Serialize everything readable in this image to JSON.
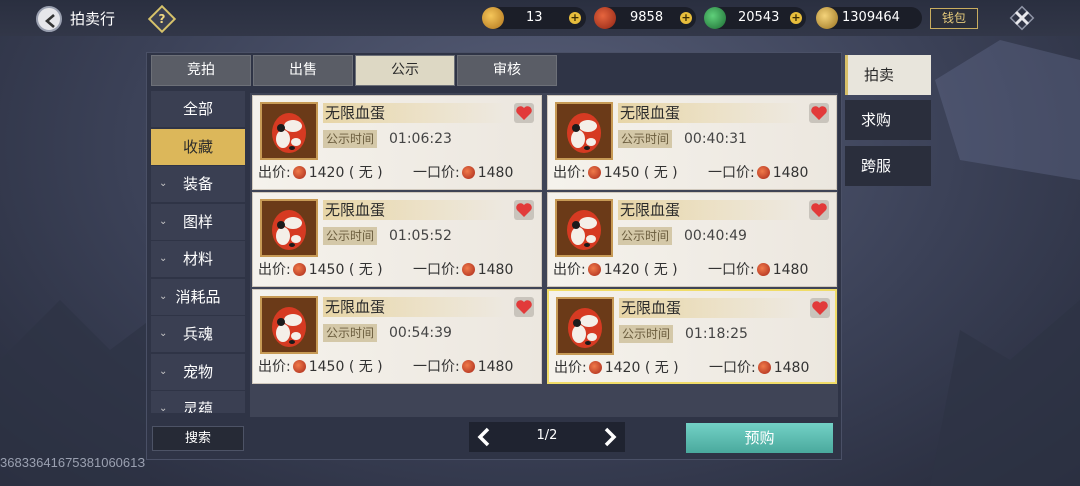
{
  "header": {
    "title": "拍卖行",
    "help_icon": "?",
    "wallet_label": "钱包",
    "currencies": [
      {
        "icon": "gold-medal-icon",
        "value": "13",
        "color": "#e0a43a"
      },
      {
        "icon": "red-coin-icon",
        "value": "9858",
        "color": "#c2432a"
      },
      {
        "icon": "jade-icon",
        "value": "20543",
        "color": "#2fa04c"
      },
      {
        "icon": "gold-ingot-icon",
        "value": "1309464",
        "color": "#d9b24a"
      }
    ]
  },
  "tabs": [
    "竞拍",
    "出售",
    "公示",
    "审核"
  ],
  "active_tab": "公示",
  "categories": [
    {
      "label": "全部",
      "expandable": false
    },
    {
      "label": "收藏",
      "expandable": false
    },
    {
      "label": "装备",
      "expandable": true
    },
    {
      "label": "图样",
      "expandable": true
    },
    {
      "label": "材料",
      "expandable": true
    },
    {
      "label": "消耗品",
      "expandable": true
    },
    {
      "label": "兵魂",
      "expandable": true
    },
    {
      "label": "宠物",
      "expandable": true
    },
    {
      "label": "灵蕴",
      "expandable": true
    }
  ],
  "active_category": "收藏",
  "labels": {
    "time": "公示时间",
    "bid": "出价:",
    "buyout": "一口价:",
    "none": "( 无 )"
  },
  "items": [
    {
      "name": "无限血蛋",
      "time": "01:06:23",
      "bid": "1420",
      "buyout": "1480"
    },
    {
      "name": "无限血蛋",
      "time": "00:40:31",
      "bid": "1450",
      "buyout": "1480"
    },
    {
      "name": "无限血蛋",
      "time": "01:05:52",
      "bid": "1450",
      "buyout": "1480"
    },
    {
      "name": "无限血蛋",
      "time": "00:40:49",
      "bid": "1420",
      "buyout": "1480"
    },
    {
      "name": "无限血蛋",
      "time": "00:54:39",
      "bid": "1450",
      "buyout": "1480"
    },
    {
      "name": "无限血蛋",
      "time": "01:18:25",
      "bid": "1420",
      "buyout": "1480"
    }
  ],
  "bottom": {
    "search_label": "搜索",
    "page": "1/2",
    "prebuy_label": "预购",
    "uid": "3683364167538106061З"
  },
  "right_tabs": [
    "拍卖",
    "求购",
    "跨服"
  ],
  "active_right_tab": "拍卖"
}
